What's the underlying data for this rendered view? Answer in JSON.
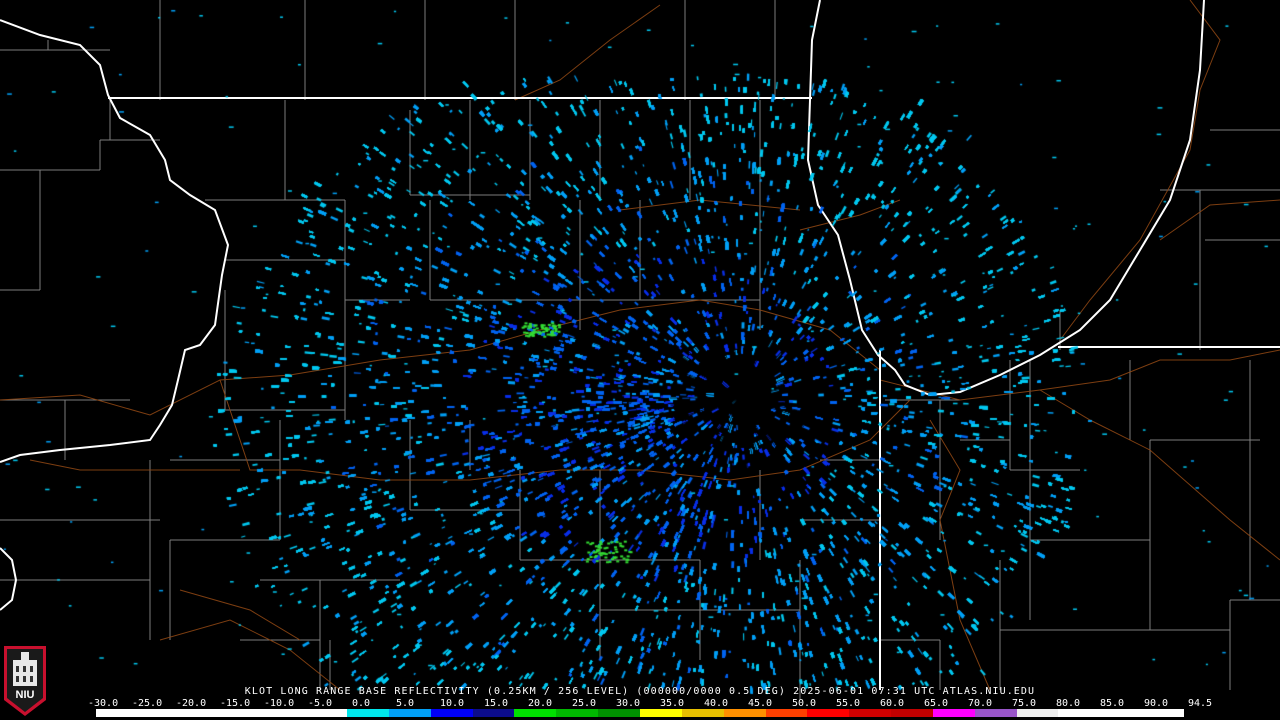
{
  "product": {
    "info_line": "KLOT LONG RANGE BASE REFLECTIVITY (0.25KM / 256 LEVEL) (000000/0000 0.5 DEG) 2025-06-01 07:31 UTC  ATLAS.NIU.EDU"
  },
  "logo": {
    "text": "NIU"
  },
  "legend": {
    "labels": [
      "-30.0",
      "-25.0",
      "-20.0",
      "-15.0",
      "-10.0",
      "-5.0",
      "0.0",
      "5.0",
      "10.0",
      "15.0",
      "20.0",
      "25.0",
      "30.0",
      "35.0",
      "40.0",
      "45.0",
      "50.0",
      "55.0",
      "60.0",
      "65.0",
      "70.0",
      "75.0",
      "80.0",
      "85.0",
      "90.0",
      "94.5"
    ],
    "colors": [
      "#ffffff",
      "#ffffff",
      "#ffffff",
      "#ffffff",
      "#ffffff",
      "#ffffff",
      "#00e7ec",
      "#01a0f6",
      "#0000f6",
      "#0c0c8c",
      "#00e000",
      "#00b800",
      "#009000",
      "#ffff00",
      "#e7c000",
      "#ff9000",
      "#ff4000",
      "#ff0000",
      "#d00000",
      "#c00000",
      "#ff00ff",
      "#9955c9",
      "#eeeeee",
      "#ffffff",
      "#ffffff",
      "#ffffff"
    ]
  },
  "map_colors": {
    "background": "#000000",
    "state_border": "#ffffff",
    "county_border": "#8a8a8a",
    "road": "#8b4513",
    "echo_colors": [
      "#01c8f0",
      "#00a0f6",
      "#0064f0",
      "#0a2fe6",
      "#2a50d8",
      "#33dd33"
    ]
  }
}
